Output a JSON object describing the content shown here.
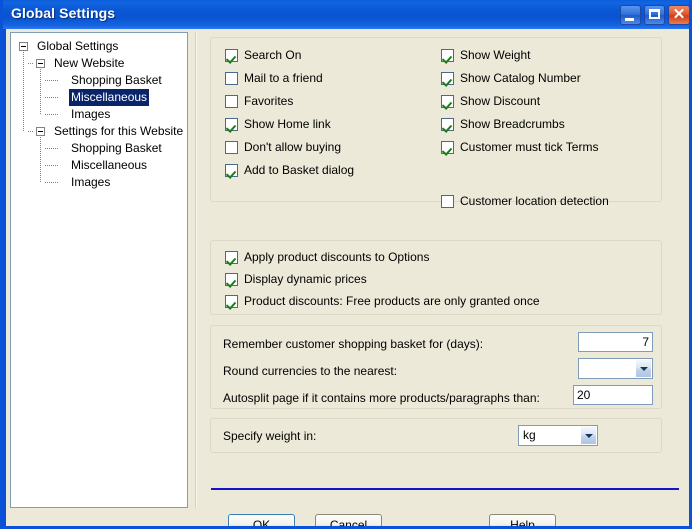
{
  "window": {
    "title": "Global Settings",
    "controls": {
      "minimize": "minimize-button",
      "maximize": "maximize-button",
      "close": "close-button"
    }
  },
  "tree": {
    "nodes": [
      {
        "label": "Global Settings",
        "level": 0,
        "expandable": true,
        "selected": false
      },
      {
        "label": "New Website",
        "level": 1,
        "expandable": true,
        "selected": false
      },
      {
        "label": "Shopping Basket",
        "level": 2,
        "expandable": false,
        "selected": false
      },
      {
        "label": "Miscellaneous",
        "level": 2,
        "expandable": false,
        "selected": true
      },
      {
        "label": "Images",
        "level": 2,
        "expandable": false,
        "selected": false
      },
      {
        "label": "Settings for this Website",
        "level": 1,
        "expandable": true,
        "selected": false
      },
      {
        "label": "Shopping Basket",
        "level": 2,
        "expandable": false,
        "selected": false
      },
      {
        "label": "Miscellaneous",
        "level": 2,
        "expandable": false,
        "selected": false
      },
      {
        "label": "Images",
        "level": 2,
        "expandable": false,
        "selected": false
      }
    ]
  },
  "display_group": {
    "left_column": [
      {
        "label": "Search On",
        "checked": true
      },
      {
        "label": "Mail to a friend",
        "checked": false
      },
      {
        "label": "Favorites",
        "checked": false
      },
      {
        "label": "Show Home link",
        "checked": true
      },
      {
        "label": "Don't allow buying",
        "checked": false
      },
      {
        "label": "Add to Basket dialog",
        "checked": true
      }
    ],
    "right_column": [
      {
        "label": "Show Weight",
        "checked": true
      },
      {
        "label": "Show Catalog Number",
        "checked": true
      },
      {
        "label": "Show Discount",
        "checked": true
      },
      {
        "label": "Show Breadcrumbs",
        "checked": true
      },
      {
        "label": "Customer must tick Terms",
        "checked": true
      },
      {
        "label": "Customer location detection",
        "checked": false
      }
    ]
  },
  "discount_group": {
    "items": [
      {
        "label": "Apply product discounts to Options",
        "checked": true
      },
      {
        "label": "Display dynamic prices",
        "checked": true
      },
      {
        "label": "Product discounts: Free products are only granted once",
        "checked": true
      }
    ]
  },
  "fields_group": {
    "remember_basket": {
      "label": "Remember customer shopping basket for (days):",
      "value": "7",
      "placeholder": ""
    },
    "round_currencies": {
      "label": "Round currencies to the nearest:",
      "value": "",
      "options": [
        ""
      ]
    },
    "autosplit": {
      "label": "Autosplit page if it contains more products/paragraphs than:",
      "value": "20",
      "placeholder": ""
    }
  },
  "weight_group": {
    "label": "Specify weight in:",
    "value": "kg",
    "options": [
      "kg"
    ]
  },
  "buttons": {
    "ok": "OK",
    "cancel": "Cancel",
    "help": "Help"
  }
}
